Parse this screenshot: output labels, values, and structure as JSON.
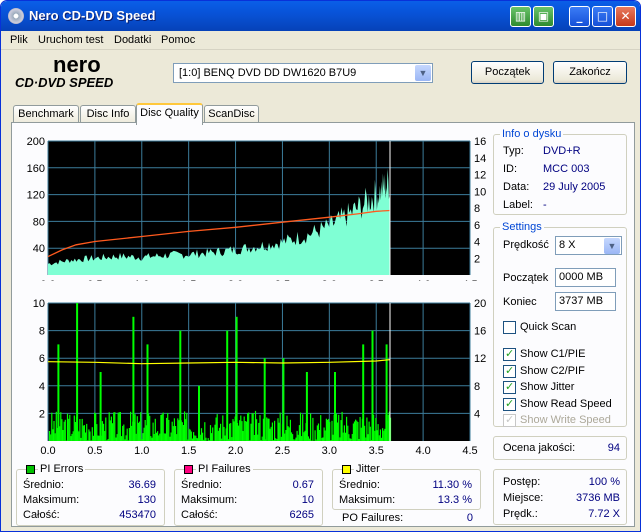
{
  "window": {
    "title": "Nero CD-DVD Speed"
  },
  "menu": [
    "Plik",
    "Uruchom test",
    "Dodatki",
    "Pomoc"
  ],
  "logo": {
    "top": "nero",
    "bottom": "CD·DVD SPEED"
  },
  "drive": {
    "selected": "[1:0]  BENQ DVD DD DW1620 B7U9"
  },
  "buttons": {
    "start": "Początek",
    "exit": "Zakończ"
  },
  "tabs": [
    "Benchmark",
    "Disc Info",
    "Disc Quality",
    "ScanDisc"
  ],
  "active_tab": "Disc Quality",
  "disc_info": {
    "title": "Info o dysku",
    "rows": [
      {
        "label": "Typ:",
        "value": "DVD+R"
      },
      {
        "label": "ID:",
        "value": "MCC 003"
      },
      {
        "label": "Data:",
        "value": "29 July 2005"
      },
      {
        "label": "Label:",
        "value": "-"
      }
    ]
  },
  "settings": {
    "title": "Settings",
    "speed_label": "Prędkość",
    "speed_value": "8 X",
    "start_label": "Początek",
    "start_value": "0000 MB",
    "end_label": "Koniec",
    "end_value": "3737 MB",
    "quick_scan": "Quick Scan",
    "checks": [
      {
        "label": "Show C1/PIE",
        "checked": true,
        "enabled": true
      },
      {
        "label": "Show C2/PIF",
        "checked": true,
        "enabled": true
      },
      {
        "label": "Show Jitter",
        "checked": true,
        "enabled": true
      },
      {
        "label": "Show Read Speed",
        "checked": true,
        "enabled": true
      },
      {
        "label": "Show Write Speed",
        "checked": true,
        "enabled": false
      }
    ]
  },
  "quality": {
    "label": "Ocena jakości:",
    "value": "94"
  },
  "progress": {
    "rows": [
      {
        "label": "Postęp:",
        "value": "100 %"
      },
      {
        "label": "Miejsce:",
        "value": "3736 MB"
      },
      {
        "label": "Prędk.:",
        "value": "7.72 X"
      }
    ]
  },
  "pi_errors": {
    "title": "PI Errors",
    "color": "#00c000",
    "rows": [
      {
        "label": "Średnio:",
        "value": "36.69"
      },
      {
        "label": "Maksimum:",
        "value": "130"
      },
      {
        "label": "Całość:",
        "value": "453470"
      }
    ]
  },
  "pi_failures": {
    "title": "PI Failures",
    "color": "#ff0080",
    "rows": [
      {
        "label": "Średnio:",
        "value": "0.67"
      },
      {
        "label": "Maksimum:",
        "value": "10"
      },
      {
        "label": "Całość:",
        "value": "6265"
      }
    ]
  },
  "jitter": {
    "title": "Jitter",
    "color": "#ffff00",
    "rows": [
      {
        "label": "Średnio:",
        "value": "11.30 %"
      },
      {
        "label": "Maksimum:",
        "value": "13.3 %"
      }
    ]
  },
  "po_failures": {
    "label": "PO Failures:",
    "value": "0"
  },
  "chart_data": [
    {
      "type": "area",
      "x_ticks": [
        "0.0",
        "0.5",
        "1.0",
        "1.5",
        "2.0",
        "2.5",
        "3.0",
        "3.5",
        "4.0",
        "4.5"
      ],
      "y_left_ticks": [
        "40",
        "80",
        "120",
        "160",
        "200"
      ],
      "y_right_ticks": [
        "2",
        "4",
        "6",
        "8",
        "10",
        "12",
        "14",
        "16"
      ],
      "ylim_left": [
        0,
        200
      ],
      "ylim_right": [
        0,
        16
      ],
      "xlim": [
        0,
        4.5
      ],
      "series": [
        {
          "x": [
            0.0,
            0.25,
            0.5,
            0.75,
            1.0,
            1.25,
            1.5,
            1.75,
            2.0,
            2.25,
            2.5,
            2.75,
            3.0,
            3.2,
            3.4,
            3.55,
            3.65
          ],
          "values": [
            12,
            16,
            18,
            20,
            19,
            21,
            22,
            24,
            27,
            31,
            35,
            42,
            52,
            64,
            78,
            90,
            100
          ]
        },
        {
          "x": [
            0.0,
            0.15,
            0.3,
            0.5,
            1.0,
            1.5,
            2.0,
            2.5,
            3.0,
            3.3,
            3.5,
            3.65
          ],
          "values": [
            2.2,
            3.0,
            3.6,
            4.0,
            4.6,
            5.2,
            5.7,
            6.3,
            6.9,
            7.3,
            7.6,
            7.7
          ]
        }
      ]
    },
    {
      "type": "bar",
      "x_ticks": [
        "0.0",
        "0.5",
        "1.0",
        "1.5",
        "2.0",
        "2.5",
        "3.0",
        "3.5",
        "4.0",
        "4.5"
      ],
      "y_left_ticks": [
        "2",
        "4",
        "6",
        "8",
        "10"
      ],
      "y_right_ticks": [
        "4",
        "8",
        "12",
        "16",
        "20"
      ],
      "ylim_left": [
        0,
        10
      ],
      "ylim_right": [
        0,
        20
      ],
      "xlim": [
        0,
        4.5
      ],
      "series": [
        {
          "x": [
            0.1,
            0.3,
            0.55,
            0.9,
            1.05,
            1.4,
            1.6,
            1.9,
            2.0,
            2.3,
            2.5,
            2.75,
            3.05,
            3.35,
            3.45,
            3.6
          ],
          "values": [
            7,
            10,
            5,
            9,
            7,
            8,
            4,
            8,
            9,
            6,
            6,
            5,
            5,
            7,
            8,
            7
          ]
        },
        {
          "x": [
            0.0,
            0.5,
            1.0,
            1.5,
            2.0,
            2.5,
            3.0,
            3.5,
            3.65
          ],
          "values": [
            11.5,
            11.4,
            11.2,
            11.3,
            11.4,
            11.3,
            11.4,
            11.6,
            11.8
          ]
        }
      ]
    }
  ]
}
